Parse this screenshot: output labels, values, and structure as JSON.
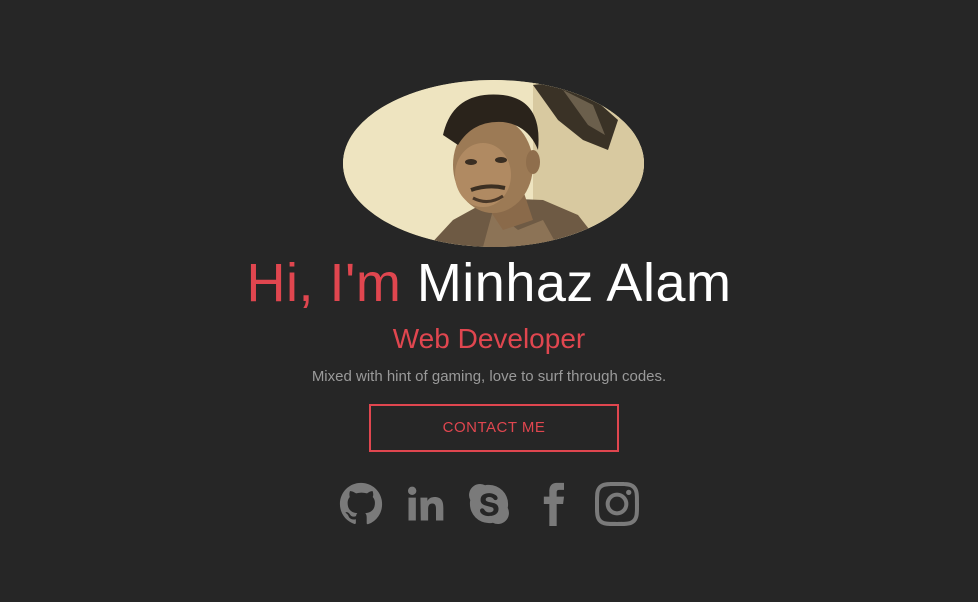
{
  "hero": {
    "avatar_alt": "Profile photo",
    "greeting": "Hi, I'm ",
    "name": "Minhaz Alam",
    "role": "Web Developer",
    "tagline": "Mixed with hint of gaming, love to surf through codes.",
    "contact_label": "CONTACT ME"
  },
  "socials": [
    {
      "icon": "github-icon"
    },
    {
      "icon": "linkedin-icon"
    },
    {
      "icon": "skype-icon"
    },
    {
      "icon": "facebook-icon"
    },
    {
      "icon": "instagram-icon"
    }
  ],
  "colors": {
    "background": "#262626",
    "accent": "#e0464f",
    "name": "#ffffff",
    "tagline": "#9a9a9a",
    "social_icon": "#7a7a7a"
  }
}
